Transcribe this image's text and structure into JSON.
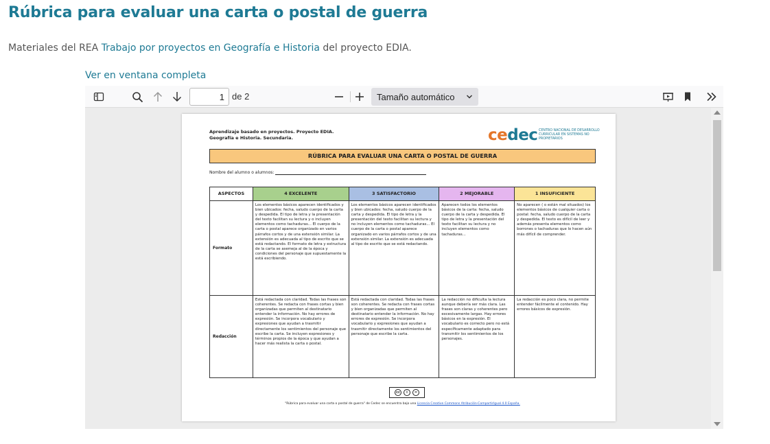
{
  "page": {
    "title": "Rúbrica para evaluar una carta o postal de guerra",
    "intro_prefix": "Materiales del REA ",
    "intro_link": "Trabajo por proyectos en Geografía e Historia",
    "intro_suffix": " del proyecto EDIA.",
    "fullview_link": "Ver en ventana completa"
  },
  "viewer": {
    "current_page": "1",
    "page_of": "de 2",
    "zoom": "Tamaño automático",
    "icons": [
      "sidebar-toggle-icon",
      "search-icon",
      "arrow-up-icon",
      "arrow-down-icon",
      "zoom-out-icon",
      "zoom-in-icon",
      "presentation-icon",
      "bookmark-icon",
      "double-chevron-right-icon"
    ]
  },
  "document": {
    "header_line1": "Aprendizaje basado en proyectos. Proyecto EDIA.",
    "header_line2": "Geografía e Historia. Secundaria.",
    "logo_text": "cedec",
    "logo_sub": "CENTRO NACIONAL DE DESARROLLO CURRICULAR EN SISTEMAS NO PROPIETARIOS",
    "title": "RÚBRICA PARA EVALUAR UNA CARTA O POSTAL DE GUERRA",
    "student_label": "Nombre del alumno o alumnos:",
    "headers": [
      "ASPECTOS",
      "4 EXCELENTE",
      "3 SATISFACTORIO",
      "2 MEJORABLE",
      "1 INSUFICIENTE"
    ],
    "rows": [
      {
        "aspect": "Formato",
        "cells": [
          "Los elementos básicos aparecen identificados y bien ubicados: fecha, saludo cuerpo de la carta y despedida. El tipo de letra y la presentación del texto facilitan su lectura y o incluyen elementos como tachaduras... El cuerpo de la carta o postal aparece organizado en varios párrafos cortos y de una extensión similar. La extensión es adecuada al tipo de escrito que se está redactando. El formato de letra y estructura de la carta se asemeja al de la época y condiciones del personaje que supuestamente la está escribiendo.",
          "Los elementos básicos aparecen identificados y bien ubicados: fecha, saludo cuerpo de la carta y despedida. El tipo de letra y la presentación del texto facilitan su lectura y no incluyen elementos como tachaduras... El cuerpo de la carta o postal aparece organizado en varios párrafos cortos y de una extensión similar. La extensión es adecuada al tipo de escrito que se está redactando.",
          "Aparecen todos los elementos básicos de la carta: fecha, saludo cuerpo de la carta y despedida. El tipo de letra y la presentación del texto facilitan su lectura y no incluyen elementos como tachaduras...",
          "No aparecen ( o están mal situados) los elementos básicos de cualquier carta o postal: fecha, saludo cuerpo de la carta y despedida. El texto es difícil de leer y además presenta elementos como borrones o tachaduras que lo hacen aún más difícil de comprender."
        ]
      },
      {
        "aspect": "Redacción",
        "cells": [
          "Está redactada con claridad. Todas las frases son coherentes. Se redacta con frases cortas y bien organizadas que permiten al destinatario entender la información. No hay errores de expresión. Se incorpora vocabulario y expresiones que ayudan a trasmitir directamente los sentimientos del personaje que escribe la carta. Se incluyen expresiones y términos propios de la época y que ayudan a hacer más realista la carta o postal.",
          "Está redactada con claridad. Todas las frases son coherentes. Se redacta con frases cortas y bien organizadas que permiten al destinatario entender la información. No hay errores de expresión. Se incorpora vocabulario y expresiones que ayudan a trasmitir directamente los sentimientos del personaje que escribe la carta.",
          "La redacción no dificulta la lectura aunque debería ser más clara. Las frases son claras y coherentes pero excesivamente largas. Hay errores básicos en la expresión. El vocabulario es correcto pero no está específicamente adaptado para transmitir los sentimientos de los personajes.",
          "La redacción es poco clara, no permite entender fácilmente el contenido. Hay errores básicos de expresión."
        ]
      }
    ],
    "license_prefix": "\"Rúbrica para evaluar una carta o postal de guerra\" de Cedec se encuentra bajo una ",
    "license_link": "Licencia Creative Commons Atribución-CompartirIgual 4.0 España."
  },
  "colors": {
    "accent": "#1e7a94",
    "title_band": "#f9c77d",
    "excelente": "#a8d08d",
    "satisfactorio": "#a9bfe3",
    "mejorable": "#e5b6ef",
    "insuficiente": "#fbe497"
  }
}
